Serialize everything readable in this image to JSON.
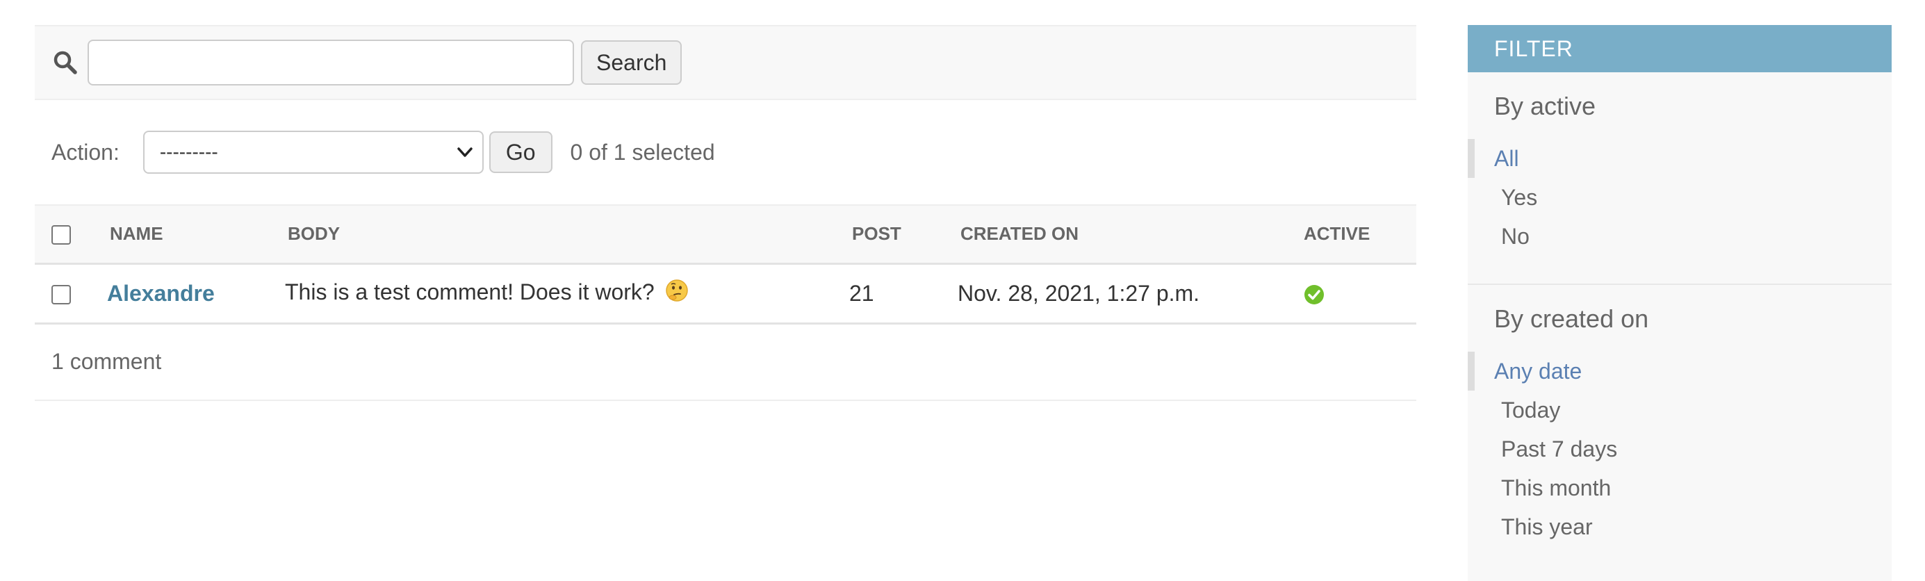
{
  "search": {
    "value": "",
    "placeholder": "",
    "button_label": "Search"
  },
  "actions": {
    "label": "Action:",
    "selected_option": "---------",
    "go_label": "Go",
    "selection_count": "0 of 1 selected"
  },
  "table": {
    "columns": [
      "Name",
      "Body",
      "Post",
      "Created on",
      "Active"
    ],
    "rows": [
      {
        "name": "Alexandre",
        "body": "This is a test comment! Does it work?",
        "body_emoji": "thinking-face-icon",
        "post": "21",
        "created_on": "Nov. 28, 2021, 1:27 p.m.",
        "active": "yes-icon"
      }
    ]
  },
  "paginator": {
    "text": "1 comment"
  },
  "filter": {
    "title": "FILTER",
    "sections": [
      {
        "title": "By active",
        "options": [
          "All",
          "Yes",
          "No"
        ],
        "selected": "All"
      },
      {
        "title": "By created on",
        "options": [
          "Any date",
          "Today",
          "Past 7 days",
          "This month",
          "This year"
        ],
        "selected": "Any date"
      }
    ]
  },
  "colors": {
    "link": "#447e9b",
    "filter_header": "#79aec8",
    "filter_selected": "#5b80b2",
    "active_icon": "#70bf2b"
  }
}
